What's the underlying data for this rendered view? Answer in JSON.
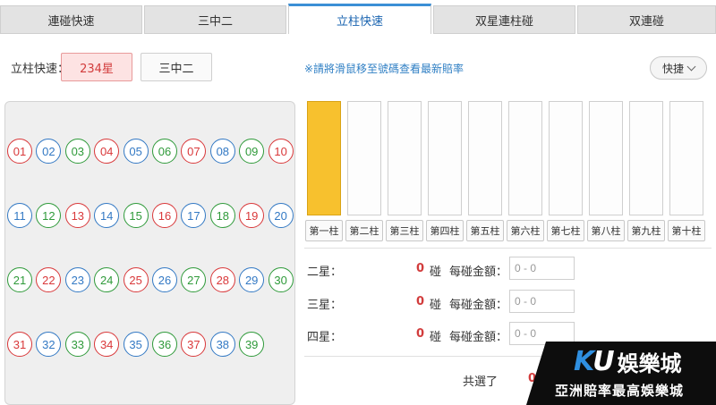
{
  "tabs": [
    {
      "label": "連碰快速",
      "active": false
    },
    {
      "label": "三中二",
      "active": false
    },
    {
      "label": "立柱快速",
      "active": true
    },
    {
      "label": "双星連柱碰",
      "active": false
    },
    {
      "label": "双連碰",
      "active": false
    }
  ],
  "selector": {
    "label": "立柱快速：",
    "options": [
      {
        "label": "234星",
        "active": true
      },
      {
        "label": "三中二",
        "active": false
      }
    ]
  },
  "hint": "※請將滑鼠移至號碼查看最新賠率",
  "quick_button": {
    "label": "快捷"
  },
  "numbers": [
    {
      "n": "01",
      "color": "red"
    },
    {
      "n": "02",
      "color": "blue"
    },
    {
      "n": "03",
      "color": "green"
    },
    {
      "n": "04",
      "color": "red"
    },
    {
      "n": "05",
      "color": "blue"
    },
    {
      "n": "06",
      "color": "green"
    },
    {
      "n": "07",
      "color": "red"
    },
    {
      "n": "08",
      "color": "blue"
    },
    {
      "n": "09",
      "color": "green"
    },
    {
      "n": "10",
      "color": "red"
    },
    {
      "n": "11",
      "color": "blue"
    },
    {
      "n": "12",
      "color": "green"
    },
    {
      "n": "13",
      "color": "red"
    },
    {
      "n": "14",
      "color": "blue"
    },
    {
      "n": "15",
      "color": "green"
    },
    {
      "n": "16",
      "color": "red"
    },
    {
      "n": "17",
      "color": "blue"
    },
    {
      "n": "18",
      "color": "green"
    },
    {
      "n": "19",
      "color": "red"
    },
    {
      "n": "20",
      "color": "blue"
    },
    {
      "n": "21",
      "color": "green"
    },
    {
      "n": "22",
      "color": "red"
    },
    {
      "n": "23",
      "color": "blue"
    },
    {
      "n": "24",
      "color": "green"
    },
    {
      "n": "25",
      "color": "red"
    },
    {
      "n": "26",
      "color": "blue"
    },
    {
      "n": "27",
      "color": "green"
    },
    {
      "n": "28",
      "color": "red"
    },
    {
      "n": "29",
      "color": "blue"
    },
    {
      "n": "30",
      "color": "green"
    },
    {
      "n": "31",
      "color": "red"
    },
    {
      "n": "32",
      "color": "blue"
    },
    {
      "n": "33",
      "color": "green"
    },
    {
      "n": "34",
      "color": "red"
    },
    {
      "n": "35",
      "color": "blue"
    },
    {
      "n": "36",
      "color": "green"
    },
    {
      "n": "37",
      "color": "red"
    },
    {
      "n": "38",
      "color": "blue"
    },
    {
      "n": "39",
      "color": "green"
    }
  ],
  "columns": [
    {
      "label": "第一柱",
      "selected": true
    },
    {
      "label": "第二柱",
      "selected": false
    },
    {
      "label": "第三柱",
      "selected": false
    },
    {
      "label": "第四柱",
      "selected": false
    },
    {
      "label": "第五柱",
      "selected": false
    },
    {
      "label": "第六柱",
      "selected": false
    },
    {
      "label": "第七柱",
      "selected": false
    },
    {
      "label": "第八柱",
      "selected": false
    },
    {
      "label": "第九柱",
      "selected": false
    },
    {
      "label": "第十柱",
      "selected": false
    }
  ],
  "rows": [
    {
      "label": "二星：",
      "count": "0",
      "unit": "碰",
      "amount_label": "每碰金額：",
      "placeholder": "0 - 0"
    },
    {
      "label": "三星：",
      "count": "0",
      "unit": "碰",
      "amount_label": "每碰金額：",
      "placeholder": "0 - 0"
    },
    {
      "label": "四星：",
      "count": "0",
      "unit": "碰",
      "amount_label": "每碰金額：",
      "placeholder": "0 - 0"
    }
  ],
  "total": {
    "label": "共選了",
    "value": "0"
  },
  "watermark": {
    "logo": "KU娛樂城",
    "tagline": "亞洲賠率最高娛樂城"
  },
  "colors": {
    "red": "#d9383a",
    "blue": "#3379c4",
    "green": "#2f9a3a",
    "accent": "#3b8fd6",
    "column_fill": "#f7c12e"
  }
}
